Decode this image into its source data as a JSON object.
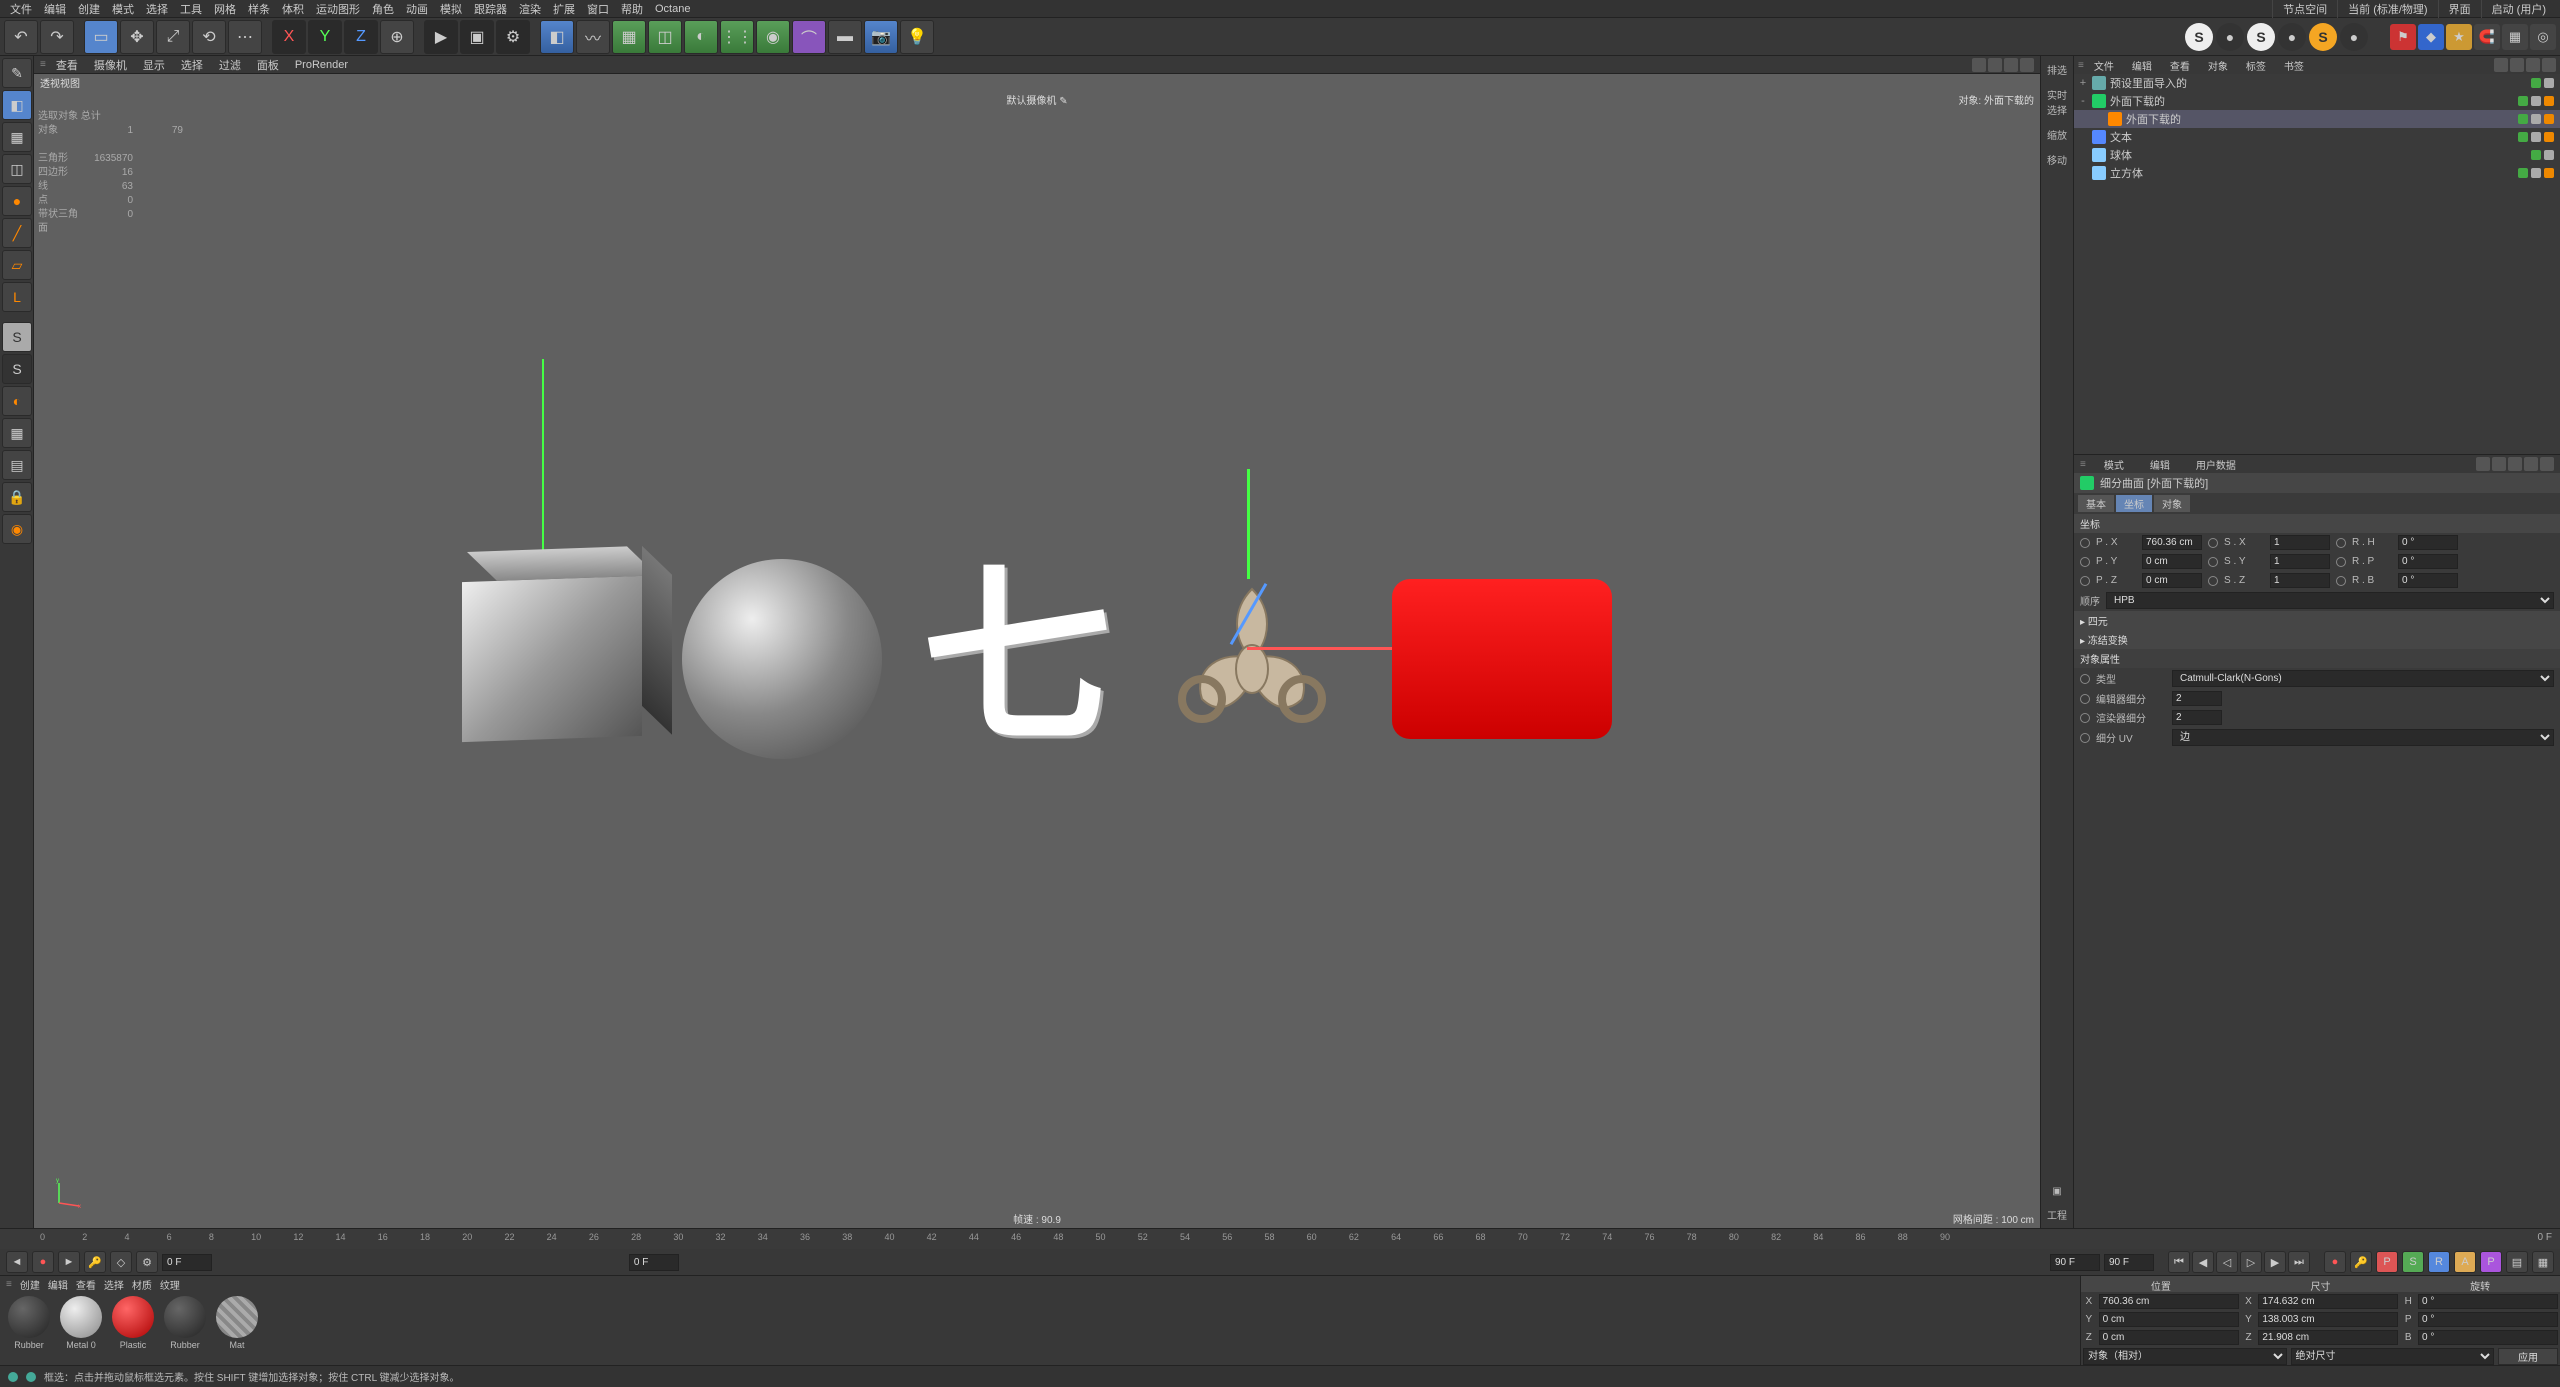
{
  "menubar": {
    "items": [
      "文件",
      "编辑",
      "创建",
      "模式",
      "选择",
      "工具",
      "网格",
      "样条",
      "体积",
      "运动图形",
      "角色",
      "动画",
      "模拟",
      "跟踪器",
      "渲染",
      "扩展",
      "窗口",
      "帮助",
      "Octane"
    ],
    "right": [
      {
        "label": "节点空间",
        "value": "当前 (标准/物理)"
      },
      {
        "label": "界面",
        "value": "启动 (用户)"
      }
    ]
  },
  "viewport": {
    "title": "透视视图",
    "menu": [
      "查看",
      "摄像机",
      "显示",
      "选择",
      "过滤",
      "面板",
      "ProRender"
    ],
    "top_center": "默认摄像机 ✎",
    "top_right": "对象: 外面下载的",
    "fps": "帧速 : 90.9",
    "grid": "网格间距 : 100 cm",
    "stats": {
      "title": "选取对象 总计",
      "rows": [
        {
          "l": "对象",
          "a": "1",
          "b": "79"
        },
        {
          "l": "",
          "a": "",
          "b": ""
        },
        {
          "l": "三角形",
          "a": "",
          "b": "1635870"
        },
        {
          "l": "四边形",
          "a": "",
          "b": "16"
        },
        {
          "l": "线",
          "a": "",
          "b": "63"
        },
        {
          "l": "点",
          "a": "",
          "b": "0"
        },
        {
          "l": "带状三角面",
          "a": "",
          "b": "0"
        }
      ]
    },
    "text3d": "七"
  },
  "right_thin": [
    "排选",
    "实时选择",
    "缩放",
    "移动"
  ],
  "right_thin_bottom": "工程",
  "object_panel": {
    "tabs": [
      "文件",
      "编辑",
      "查看",
      "对象",
      "标签",
      "书签"
    ],
    "tree": [
      {
        "indent": 0,
        "icon": "#6aa",
        "name": "预设里面导入的",
        "exp": "+",
        "dots": [
          "g",
          "w"
        ]
      },
      {
        "indent": 0,
        "icon": "#2c6",
        "name": "外面下载的",
        "exp": "-",
        "dots": [
          "g",
          "w"
        ],
        "extra": true,
        "sel": false
      },
      {
        "indent": 1,
        "icon": "#f80",
        "name": "外面下载的",
        "exp": "",
        "dots": [
          "g",
          "w"
        ],
        "extra": true,
        "sel": true
      },
      {
        "indent": 0,
        "icon": "#58f",
        "name": "文本",
        "exp": "",
        "dots": [
          "g",
          "w"
        ],
        "extra": true
      },
      {
        "indent": 0,
        "icon": "#8cf",
        "name": "球体",
        "exp": "",
        "dots": [
          "g",
          "w"
        ]
      },
      {
        "indent": 0,
        "icon": "#8cf",
        "name": "立方体",
        "exp": "",
        "dots": [
          "g",
          "w"
        ],
        "extra": true
      }
    ]
  },
  "attr_panel": {
    "tabs": [
      "模式",
      "编辑",
      "用户数据"
    ],
    "title": "细分曲面 [外面下载的]",
    "sub_tabs": [
      "基本",
      "坐标",
      "对象"
    ],
    "active_sub": "坐标",
    "section_coord": "坐标",
    "coord_rows": [
      {
        "pl": "P . X",
        "pv": "760.36 cm",
        "sl": "S . X",
        "sv": "1",
        "rl": "R . H",
        "rv": "0 °"
      },
      {
        "pl": "P . Y",
        "pv": "0 cm",
        "sl": "S . Y",
        "sv": "1",
        "rl": "R . P",
        "rv": "0 °"
      },
      {
        "pl": "P . Z",
        "pv": "0 cm",
        "sl": "S . Z",
        "sv": "1",
        "rl": "R . B",
        "rv": "0 °"
      }
    ],
    "order_label": "顺序",
    "order_value": "HPB",
    "sections": [
      "四元",
      "冻结变换"
    ],
    "props_title": "对象属性",
    "props": [
      {
        "l": "类型",
        "v": "Catmull-Clark(N-Gons)",
        "type": "select"
      },
      {
        "l": "编辑器细分",
        "v": "2",
        "type": "num"
      },
      {
        "l": "渲染器细分",
        "v": "2",
        "type": "num"
      },
      {
        "l": "细分 UV",
        "v": "边",
        "type": "select"
      }
    ]
  },
  "timeline": {
    "start": "0 F",
    "end": "0 F",
    "cur": "90 F",
    "max": "90 F",
    "ticks": [
      0,
      2,
      4,
      6,
      8,
      10,
      12,
      14,
      16,
      18,
      20,
      22,
      24,
      26,
      28,
      30,
      32,
      34,
      36,
      38,
      40,
      42,
      44,
      46,
      48,
      50,
      52,
      54,
      56,
      58,
      60,
      62,
      64,
      66,
      68,
      70,
      72,
      74,
      76,
      78,
      80,
      82,
      84,
      86,
      88,
      90
    ]
  },
  "materials": {
    "tabs": [
      "创建",
      "编辑",
      "查看",
      "选择",
      "材质",
      "纹理"
    ],
    "items": [
      {
        "name": "Rubber",
        "color": "radial-gradient(circle at 35% 30%, #666,#222)"
      },
      {
        "name": "Metal 0",
        "color": "radial-gradient(circle at 35% 30%, #eee,#888)"
      },
      {
        "name": "Plastic",
        "color": "radial-gradient(circle at 35% 30%, #f66,#a00)"
      },
      {
        "name": "Rubber",
        "color": "radial-gradient(circle at 35% 30%, #666,#222)"
      },
      {
        "name": "Mat",
        "color": "repeating-linear-gradient(45deg,#888,#888 4px,#aaa 4px,#aaa 8px)"
      }
    ]
  },
  "coord_info": {
    "headers": [
      "位置",
      "尺寸",
      "旋转"
    ],
    "rows": [
      {
        "axis": "X",
        "p": "760.36 cm",
        "s": "174.632 cm",
        "r": "H",
        "rv": "0 °"
      },
      {
        "axis": "Y",
        "p": "0 cm",
        "s": "138.003 cm",
        "r": "P",
        "rv": "0 °"
      },
      {
        "axis": "Z",
        "p": "0 cm",
        "s": "21.908 cm",
        "r": "B",
        "rv": "0 °"
      }
    ],
    "mode1": "对象（相对）",
    "mode2": "绝对尺寸",
    "apply": "应用"
  },
  "status": "框选：点击并拖动鼠标框选元素。按住 SHIFT 键增加选择对象；按住 CTRL 键减少选择对象。"
}
